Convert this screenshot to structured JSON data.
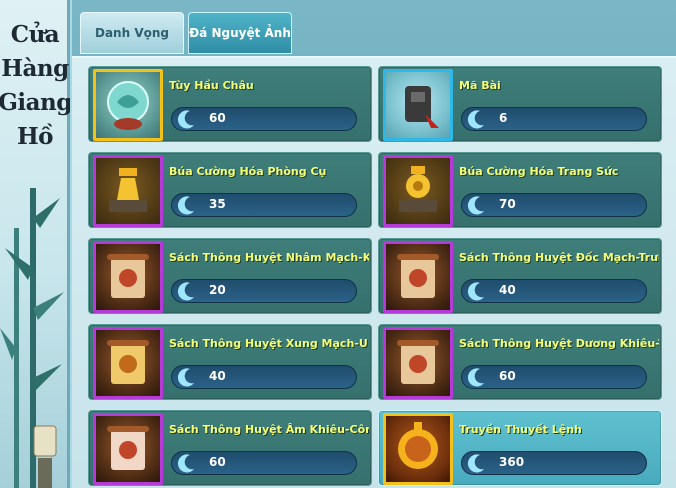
{
  "side_title": [
    "Cửa",
    "Hàng",
    "Giang",
    "Hồ"
  ],
  "tabs": [
    {
      "label": "Danh Vọng",
      "active": false
    },
    {
      "label": "Đá Nguyệt Ảnh",
      "active": true
    }
  ],
  "items": [
    {
      "name": "Tùy Hầu Châu",
      "price": "60",
      "icon": "jade-orb-icon",
      "rarity": "gold"
    },
    {
      "name": "Mã Bài",
      "price": "6",
      "icon": "tassel-token-icon",
      "rarity": "blue"
    },
    {
      "name": "Búa Cường Hóa Phòng Cụ",
      "price": "35",
      "icon": "armor-enhance-hammer-icon",
      "rarity": "purple"
    },
    {
      "name": "Búa Cường Hóa Trang Sức",
      "price": "70",
      "icon": "jewelry-enhance-hammer-icon",
      "rarity": "purple"
    },
    {
      "name": "Sách Thông Huyệt Nhâm Mạch-Khúc C",
      "price": "20",
      "icon": "scroll-icon",
      "rarity": "purple"
    },
    {
      "name": "Sách Thông Huyệt Đốc Mạch-Trường C",
      "price": "40",
      "icon": "scroll-icon",
      "rarity": "purple"
    },
    {
      "name": "Sách Thông Huyệt Xung Mạch-U Môn",
      "price": "40",
      "icon": "scroll-icon",
      "rarity": "purple"
    },
    {
      "name": "Sách Thông Huyệt Dương Khiêu-Tình M",
      "price": "60",
      "icon": "scroll-icon",
      "rarity": "purple"
    },
    {
      "name": "Sách Thông Huyệt Âm Khiêu-Công Tôn",
      "price": "60",
      "icon": "scroll-icon",
      "rarity": "purple"
    },
    {
      "name": "Truyền Thuyết Lệnh",
      "price": "360",
      "icon": "legend-token-icon",
      "rarity": "gold",
      "highlight": true
    }
  ],
  "currency_icon": "moon-stone-icon",
  "colors": {
    "name_text": "#f4ff73",
    "card_bg": "#3f7e7a",
    "card_highlight_bg": "#5fc1cf",
    "rarity_gold": "#f2c21a",
    "rarity_blue": "#2fb8e5",
    "rarity_purple": "#b63ad8"
  }
}
